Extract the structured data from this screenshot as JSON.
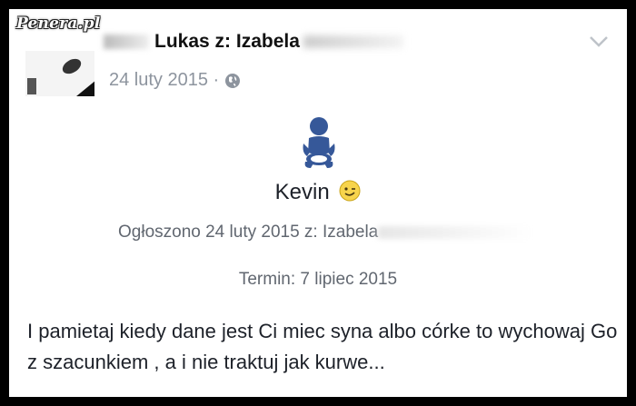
{
  "watermark": "Penera.pl",
  "post": {
    "header": "Lukas z: Izabela",
    "date": "24 luty 2015 ·",
    "icons": {
      "privacy": "globe-icon",
      "menu": "chevron-down-icon",
      "event": "baby-icon",
      "emoji": "wink-emoji-icon"
    }
  },
  "life_event": {
    "name": "Kevin",
    "announced": "Ogłoszono 24 luty 2015 z: Izabela",
    "due_date": "Termin: 7 lipiec 2015"
  },
  "message": "I pamietaj kiedy dane jest Ci miec syna albo córke to wychowaj Go z szacunkiem , a i nie traktuj jak kurwe...",
  "colors": {
    "accent": "#365899",
    "text": "#1d2129",
    "muted": "#8d949e"
  }
}
